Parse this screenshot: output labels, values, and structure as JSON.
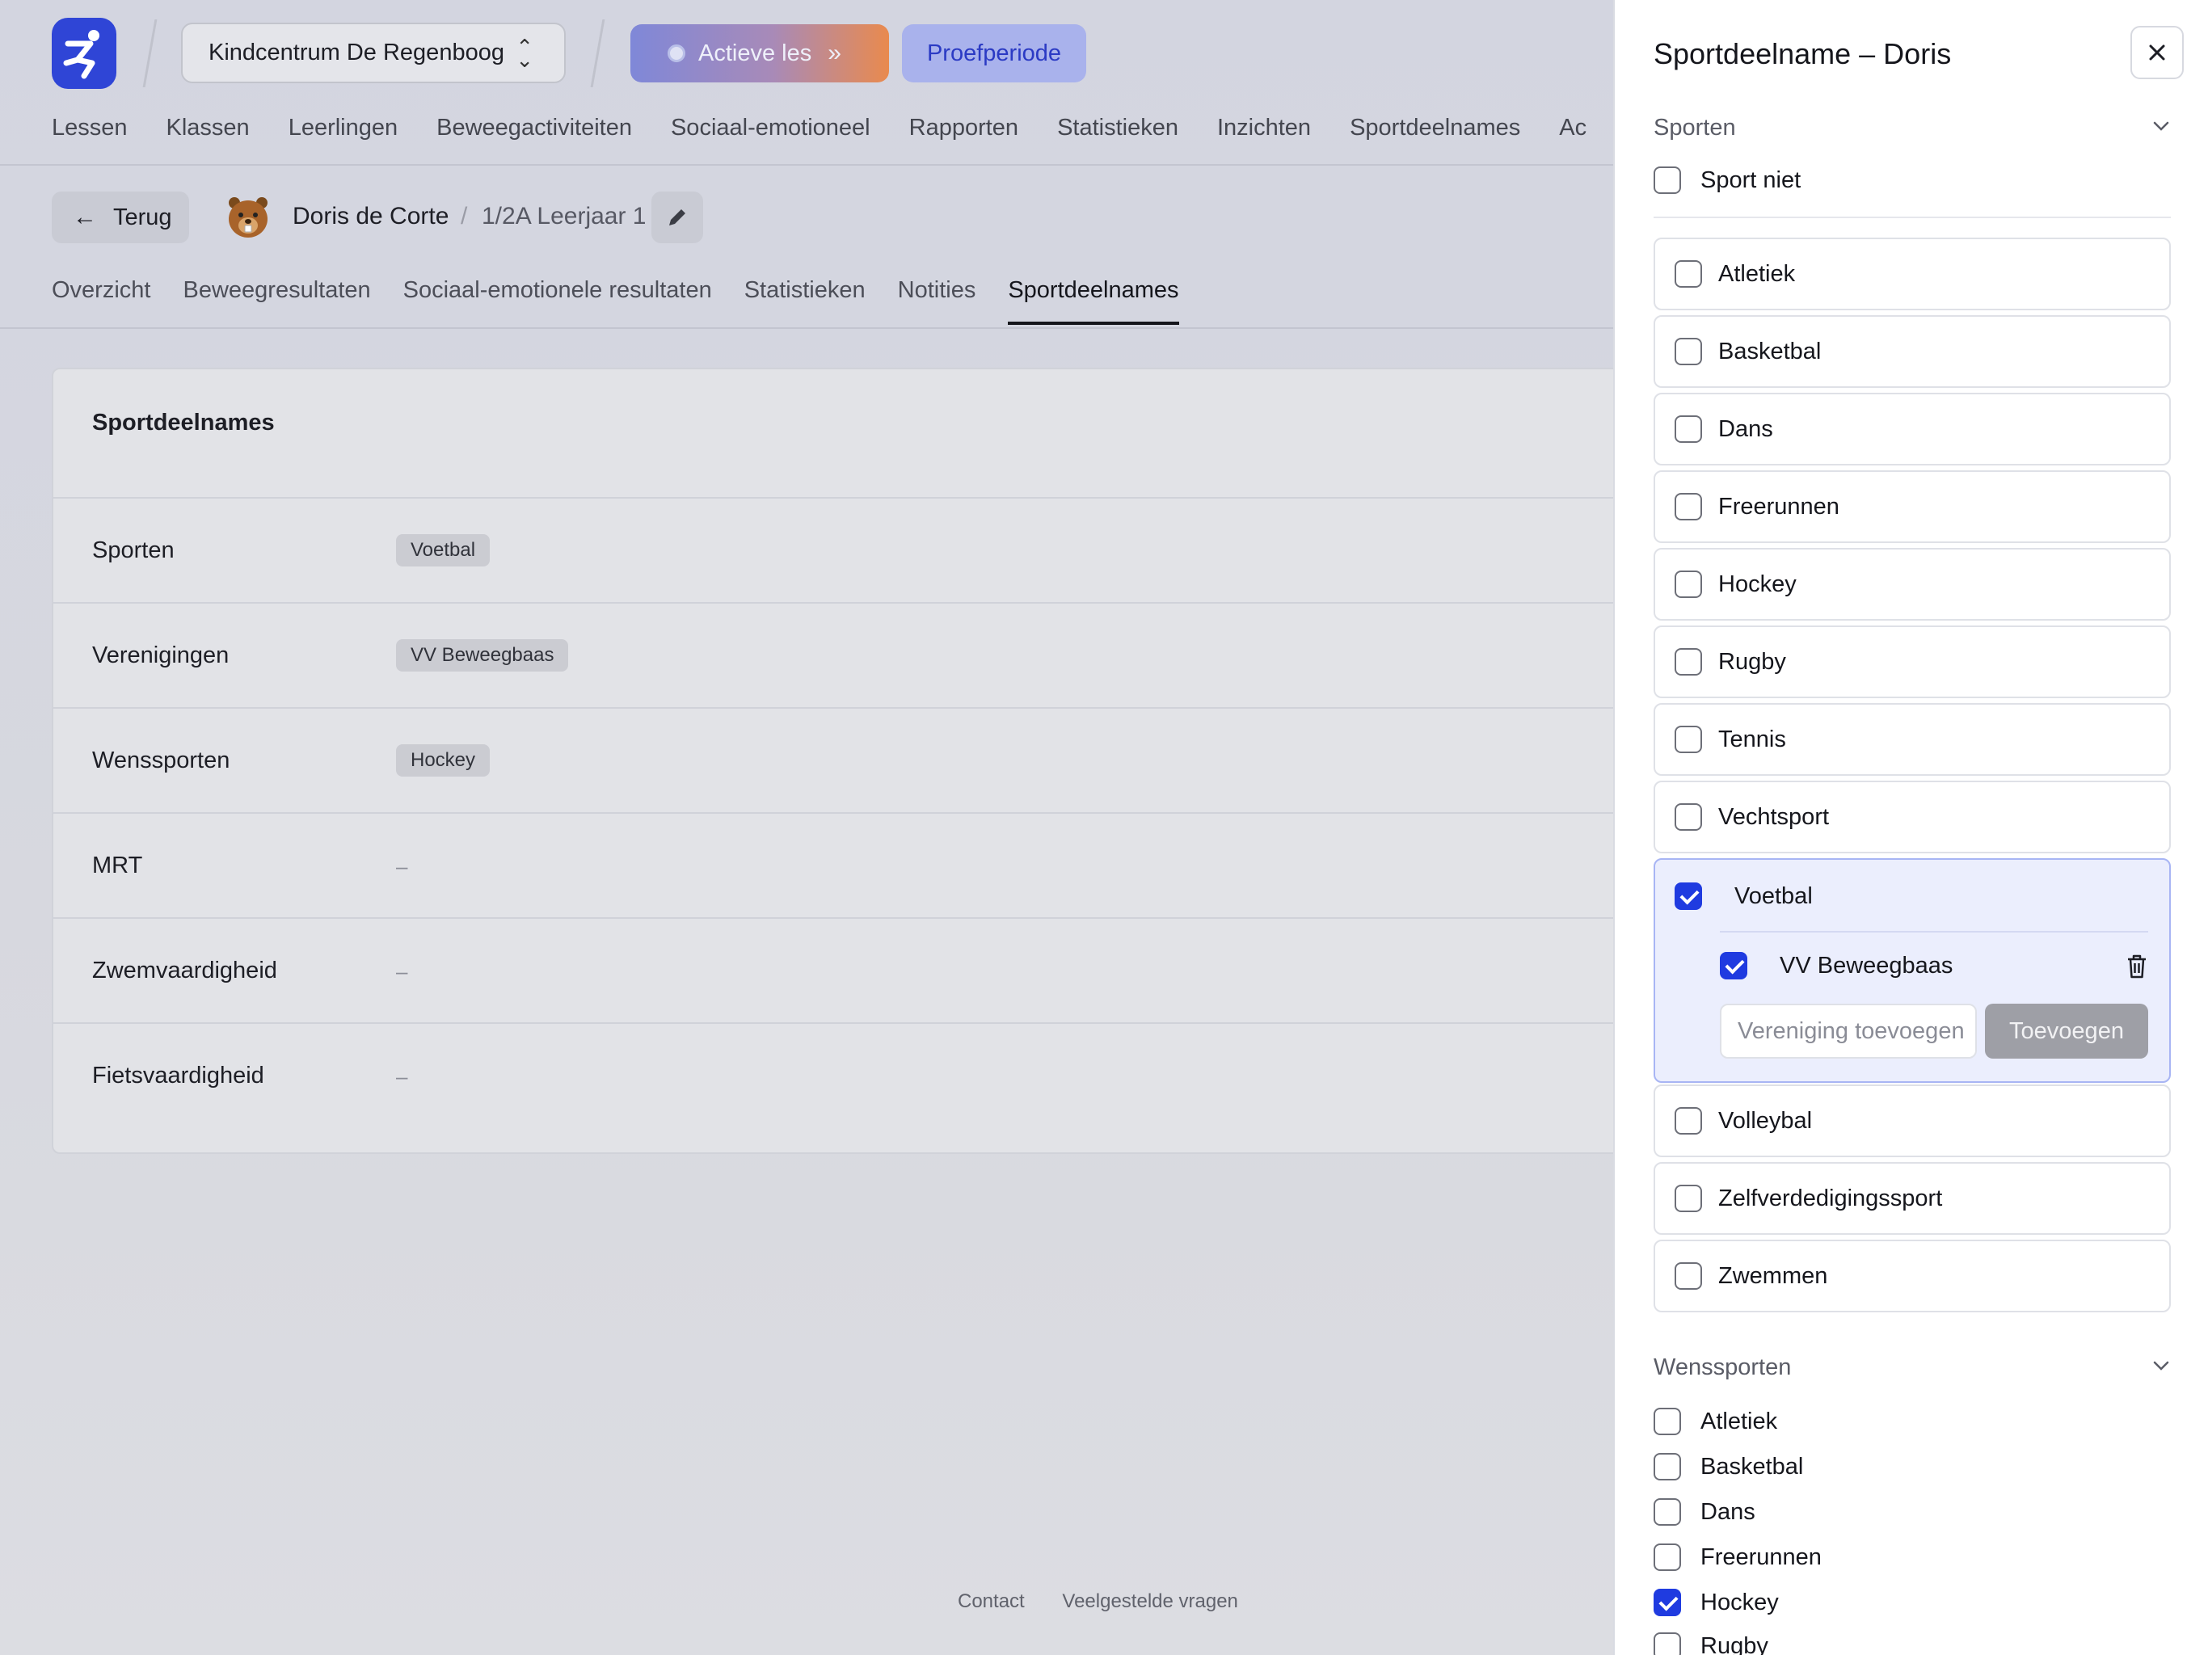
{
  "header": {
    "school": "Kindcentrum De Regenboog",
    "active_lesson": "Actieve les",
    "trial": "Proefperiode",
    "nav": [
      "Lessen",
      "Klassen",
      "Leerlingen",
      "Beweegactiviteiten",
      "Sociaal-emotioneel",
      "Rapporten",
      "Statistieken",
      "Inzichten",
      "Sportdeelnames",
      "Ac"
    ]
  },
  "subheader": {
    "back": "Terug",
    "student_name": "Doris de Corte",
    "separator": "/",
    "student_class": "1/2A Leerjaar 1",
    "tabs": [
      "Overzicht",
      "Beweegresultaten",
      "Sociaal-emotionele resultaten",
      "Statistieken",
      "Notities",
      "Sportdeelnames"
    ],
    "active_tab": "Sportdeelnames"
  },
  "card": {
    "title": "Sportdeelnames",
    "rows": [
      {
        "label": "Sporten",
        "chip": "Voetbal"
      },
      {
        "label": "Verenigingen",
        "chip": "VV Beweegbaas"
      },
      {
        "label": "Wenssporten",
        "chip": "Hockey"
      },
      {
        "label": "MRT",
        "dash": "–"
      },
      {
        "label": "Zwemvaardigheid",
        "dash": "–"
      },
      {
        "label": "Fietsvaardigheid",
        "dash": "–"
      }
    ]
  },
  "footer": {
    "links": [
      "Contact",
      "Veelgestelde vragen"
    ]
  },
  "drawer": {
    "title": "Sportdeelname – Doris",
    "sports_section": "Sporten",
    "sport_none": "Sport niet",
    "sports": [
      {
        "name": "Atletiek",
        "checked": false
      },
      {
        "name": "Basketbal",
        "checked": false
      },
      {
        "name": "Dans",
        "checked": false
      },
      {
        "name": "Freerunnen",
        "checked": false
      },
      {
        "name": "Hockey",
        "checked": false
      },
      {
        "name": "Rugby",
        "checked": false
      },
      {
        "name": "Tennis",
        "checked": false
      },
      {
        "name": "Vechtsport",
        "checked": false
      },
      {
        "name": "Voetbal",
        "checked": true
      },
      {
        "name": "Volleybal",
        "checked": false
      },
      {
        "name": "Zelfverdedigingssport",
        "checked": false
      },
      {
        "name": "Zwemmen",
        "checked": false
      }
    ],
    "club": {
      "name": "VV Beweegbaas",
      "checked": true
    },
    "club_input_placeholder": "Vereniging toevoegen",
    "add_button": "Toevoegen",
    "wish_section": "Wenssporten",
    "wish_sports": [
      {
        "name": "Atletiek",
        "checked": false
      },
      {
        "name": "Basketbal",
        "checked": false
      },
      {
        "name": "Dans",
        "checked": false
      },
      {
        "name": "Freerunnen",
        "checked": false
      },
      {
        "name": "Hockey",
        "checked": true
      },
      {
        "name": "Rugby",
        "checked": false
      }
    ]
  },
  "colors": {
    "accent": "#1f3be0",
    "brand": "#2f45d6"
  }
}
